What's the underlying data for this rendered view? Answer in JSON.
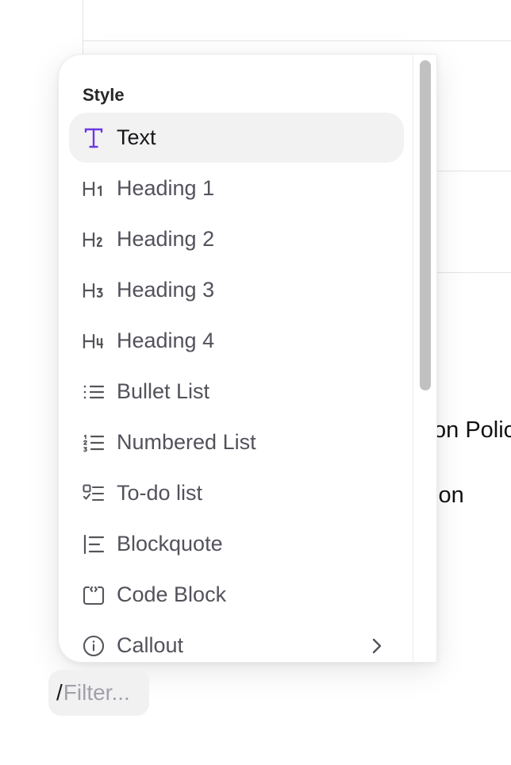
{
  "document": {
    "line_fragments": [
      "on Polic",
      "ion"
    ]
  },
  "menu": {
    "section_label": "Style",
    "items": [
      {
        "label": "Text",
        "icon": "text-type-icon",
        "active": true
      },
      {
        "label": "Heading 1",
        "icon": "heading-1-icon"
      },
      {
        "label": "Heading 2",
        "icon": "heading-2-icon"
      },
      {
        "label": "Heading 3",
        "icon": "heading-3-icon"
      },
      {
        "label": "Heading 4",
        "icon": "heading-4-icon"
      },
      {
        "label": "Bullet List",
        "icon": "bullet-list-icon"
      },
      {
        "label": "Numbered List",
        "icon": "numbered-list-icon"
      },
      {
        "label": "To-do list",
        "icon": "todo-list-icon"
      },
      {
        "label": "Blockquote",
        "icon": "blockquote-icon"
      },
      {
        "label": "Code Block",
        "icon": "code-block-icon"
      },
      {
        "label": "Callout",
        "icon": "info-icon",
        "has_submenu": true
      }
    ]
  },
  "filter": {
    "prefix": "/",
    "placeholder": "Filter...",
    "value": ""
  },
  "colors": {
    "accent": "#6d38e0",
    "active_bg": "#f2f2f3",
    "text": "#52525b"
  }
}
